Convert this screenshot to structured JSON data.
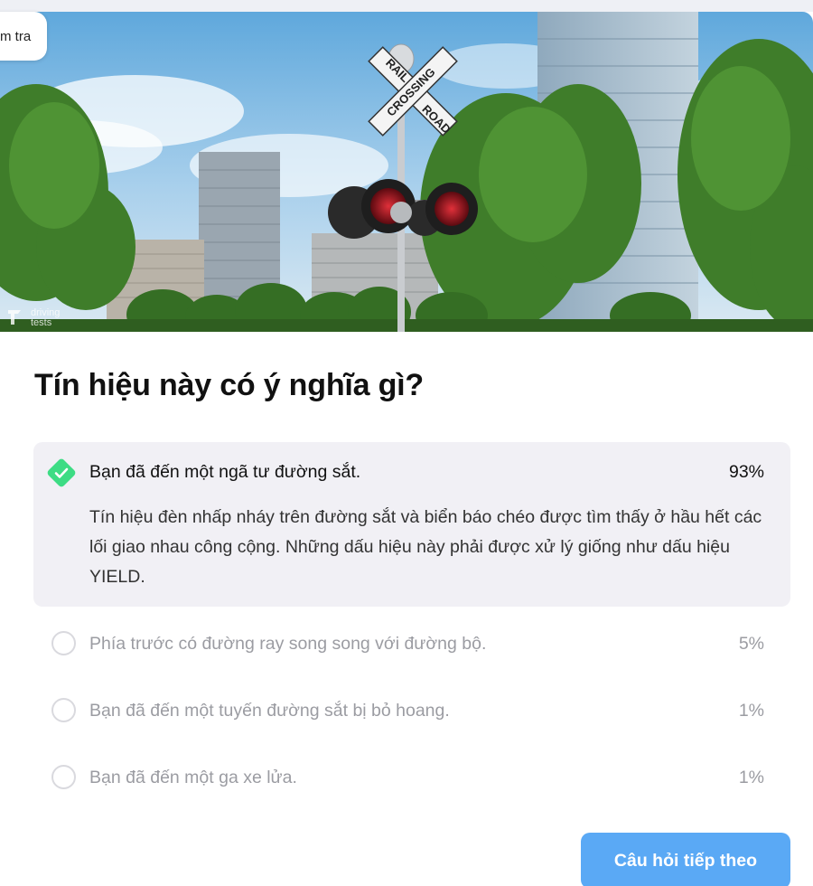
{
  "header": {
    "tab_label": "m tra"
  },
  "hero": {
    "sign_top_word": "RAIL",
    "sign_top_word_2": "ROAD",
    "sign_cross_word": "CROSSING",
    "watermark_line_1": "driving",
    "watermark_line_2": "tests"
  },
  "question": {
    "text": "Tín hiệu này có ý nghĩa gì?"
  },
  "options": [
    {
      "label": "Bạn đã đến một ngã tư đường sắt.",
      "percent": "93%",
      "selected": true,
      "correct": true,
      "explanation": "Tín hiệu đèn nhấp nháy trên đường sắt và biển báo chéo được tìm thấy ở hầu hết các lối giao nhau công cộng. Những dấu hiệu này phải được xử lý giống như dấu hiệu YIELD."
    },
    {
      "label": "Phía trước có đường ray song song với đường bộ.",
      "percent": "5%",
      "selected": false
    },
    {
      "label": "Bạn đã đến một tuyến đường sắt bị bỏ hoang.",
      "percent": "1%",
      "selected": false
    },
    {
      "label": "Bạn đã đến một ga xe lửa.",
      "percent": "1%",
      "selected": false
    }
  ],
  "actions": {
    "next_label": "Câu hỏi tiếp theo"
  },
  "colors": {
    "accent_button": "#5aa9f5",
    "correct_green": "#3ddc84",
    "selected_bg": "#f1f0f5",
    "muted_text": "#9b9ca2"
  }
}
